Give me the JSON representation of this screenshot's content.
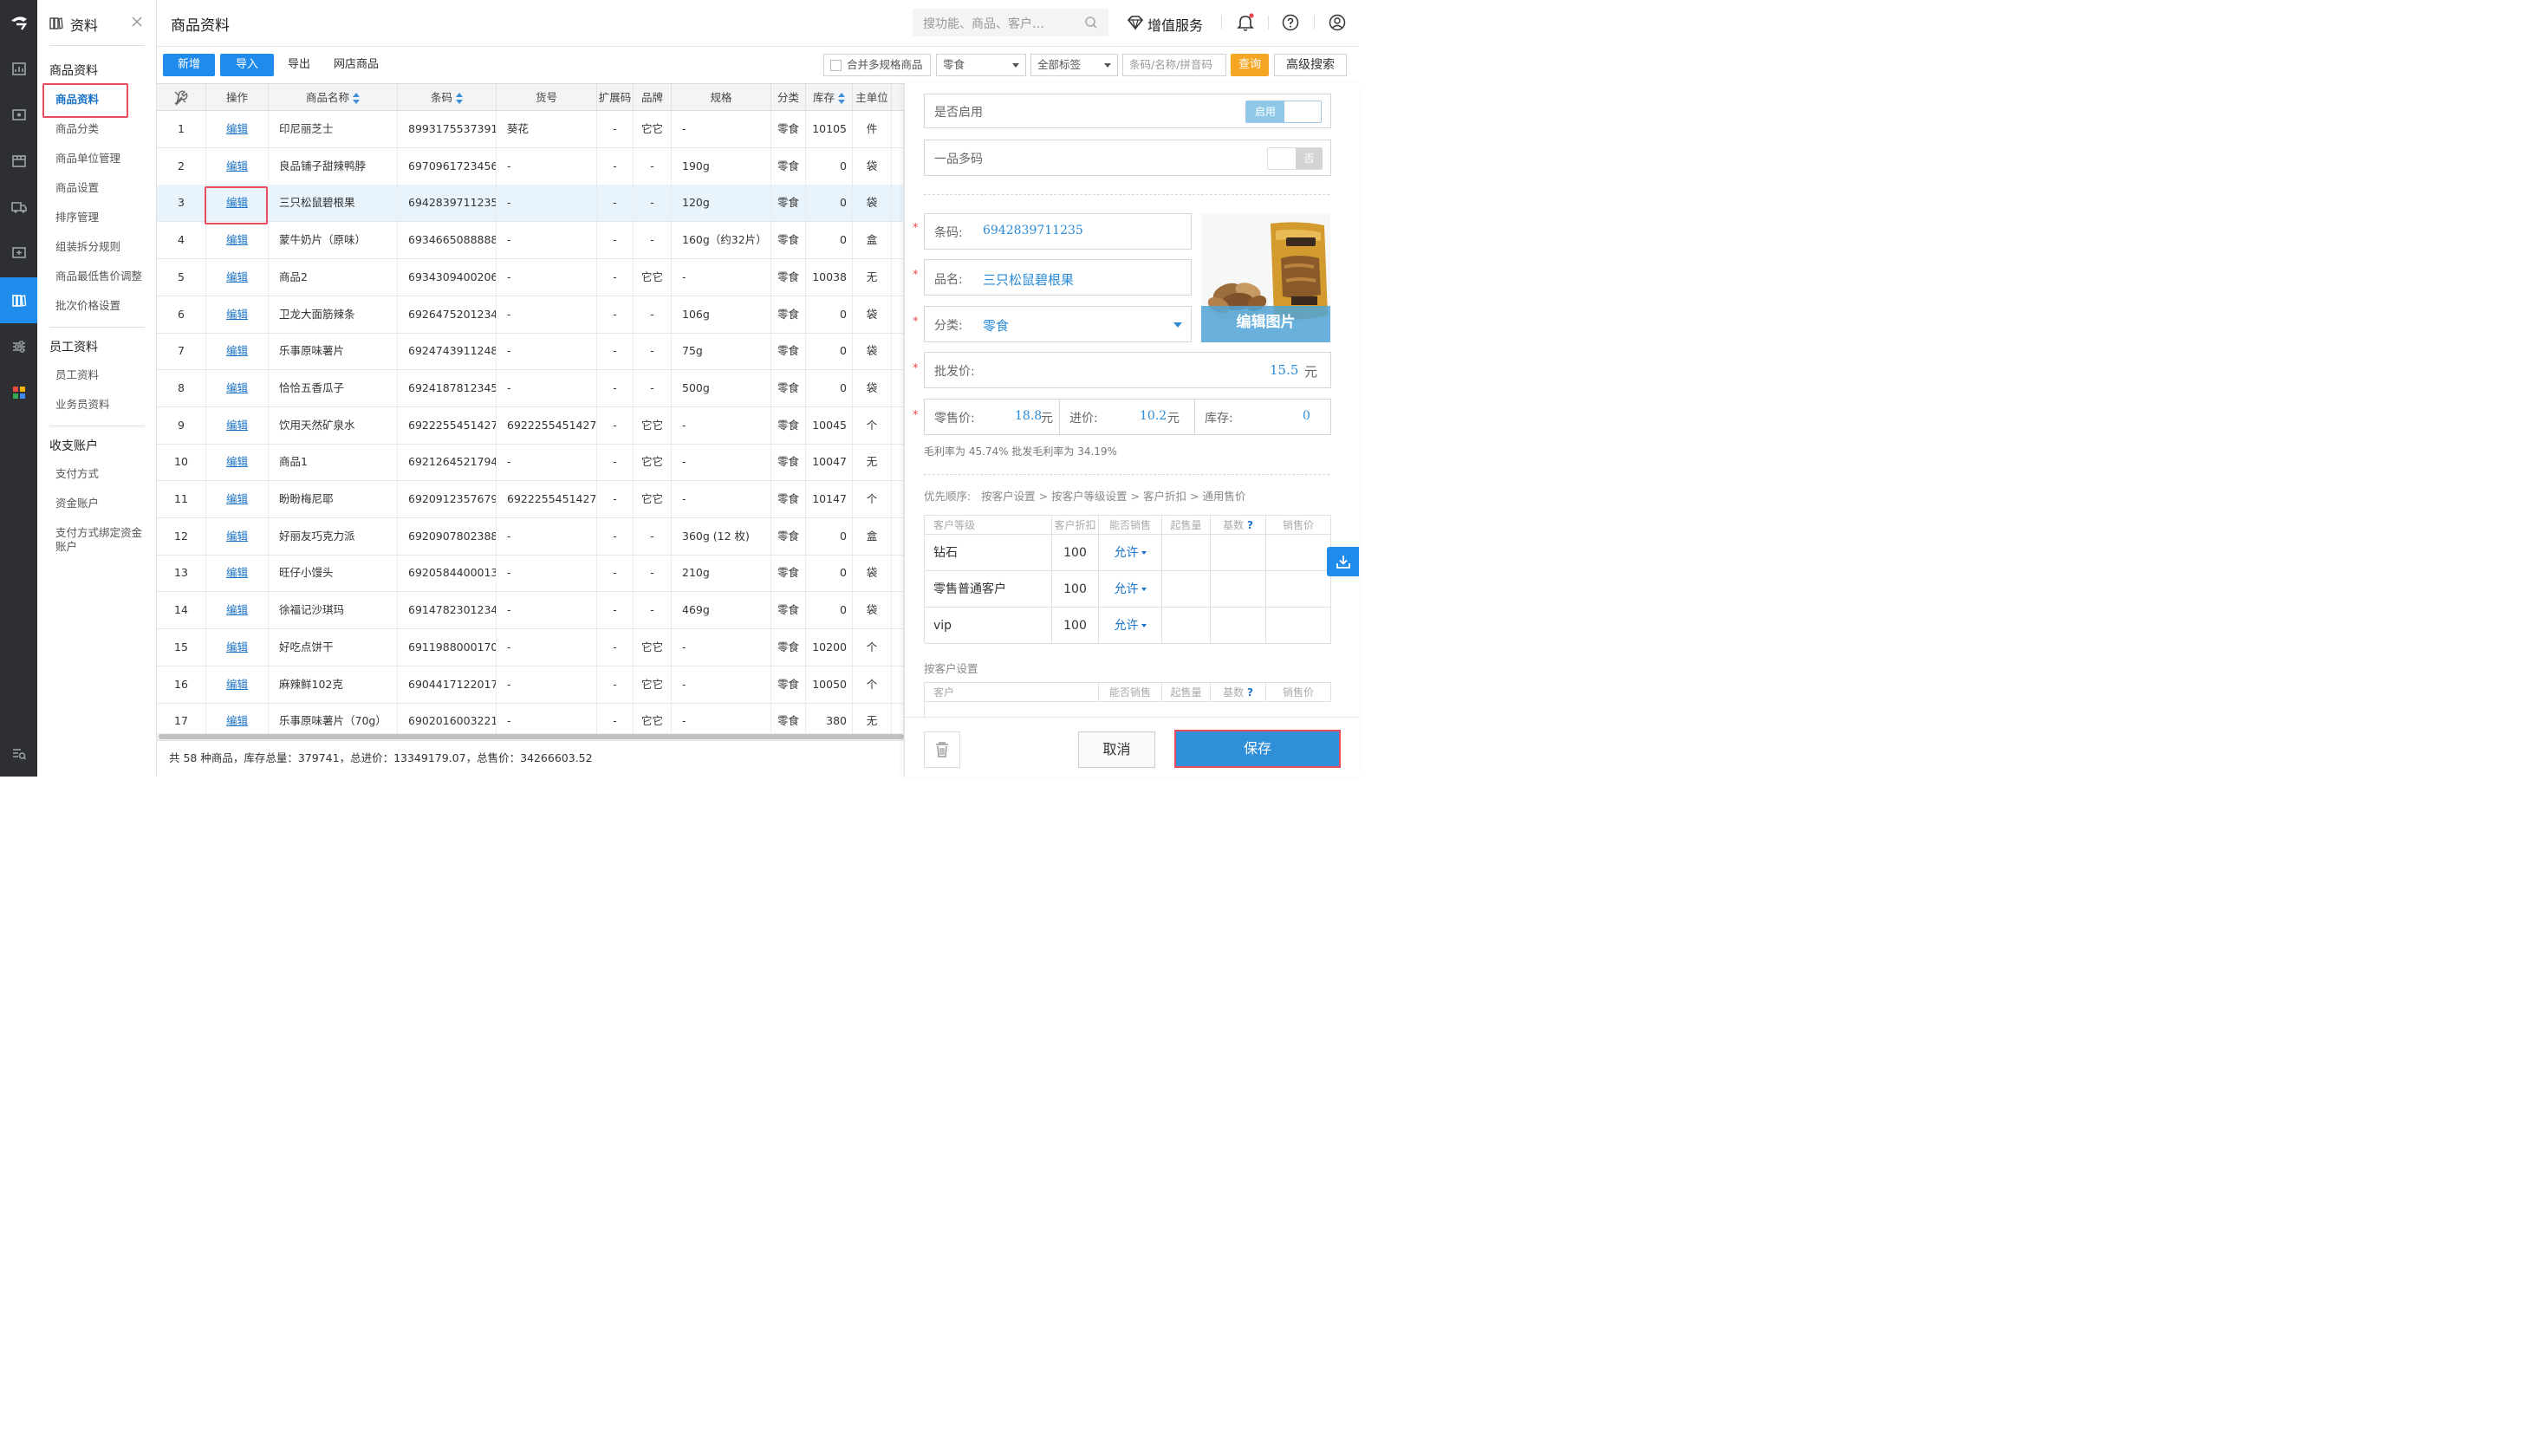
{
  "sidenav": {
    "header_title": "资料",
    "section1_title": "商品资料",
    "section1_items": [
      "商品资料",
      "商品分类",
      "商品单位管理",
      "商品设置",
      "排序管理",
      "组装拆分规则",
      "商品最低售价调整",
      "批次价格设置"
    ],
    "section2_title": "员工资料",
    "section2_items": [
      "员工资料",
      "业务员资料"
    ],
    "section3_title": "收支账户",
    "section3_items": [
      "支付方式",
      "资金账户",
      "支付方式绑定资金账户"
    ]
  },
  "header": {
    "page_title": "商品资料",
    "search_placeholder": "搜功能、商品、客户…",
    "value_service": "增值服务"
  },
  "toolbar": {
    "new_label": "新增",
    "import_label": "导入",
    "export_label": "导出",
    "online_goods_label": "网店商品",
    "merge_spec_label": "合并多规格商品",
    "category_select": "零食",
    "tag_select": "全部标签",
    "search_placeholder": "条码/名称/拼音码",
    "query_label": "查询",
    "advanced_search_label": "高级搜索"
  },
  "table": {
    "columns": [
      "操作",
      "商品名称",
      "条码",
      "货号",
      "扩展码",
      "品牌",
      "规格",
      "分类",
      "库存",
      "主单位"
    ],
    "edit_label": "编辑",
    "rows": [
      {
        "no": "1",
        "name": "印尼丽芝士",
        "barcode": "8993175537391",
        "sku": "葵花",
        "ext": "-",
        "brand": "它它",
        "spec": "-",
        "cat": "零食",
        "stock": "10105",
        "unit": "件"
      },
      {
        "no": "2",
        "name": "良品铺子甜辣鸭脖",
        "barcode": "6970961723456",
        "sku": "-",
        "ext": "-",
        "brand": "-",
        "spec": "190g",
        "cat": "零食",
        "stock": "0",
        "unit": "袋"
      },
      {
        "no": "3",
        "name": "三只松鼠碧根果",
        "barcode": "6942839711235",
        "sku": "-",
        "ext": "-",
        "brand": "-",
        "spec": "120g",
        "cat": "零食",
        "stock": "0",
        "unit": "袋"
      },
      {
        "no": "4",
        "name": "蒙牛奶片（原味）",
        "barcode": "6934665088888",
        "sku": "-",
        "ext": "-",
        "brand": "-",
        "spec": "160g（约32片）",
        "cat": "零食",
        "stock": "0",
        "unit": "盒"
      },
      {
        "no": "5",
        "name": "商品2",
        "barcode": "6934309400206",
        "sku": "-",
        "ext": "-",
        "brand": "它它",
        "spec": "-",
        "cat": "零食",
        "stock": "10038",
        "unit": "无"
      },
      {
        "no": "6",
        "name": "卫龙大面筋辣条",
        "barcode": "6926475201234",
        "sku": "-",
        "ext": "-",
        "brand": "-",
        "spec": "106g",
        "cat": "零食",
        "stock": "0",
        "unit": "袋"
      },
      {
        "no": "7",
        "name": "乐事原味薯片",
        "barcode": "6924743911248",
        "sku": "-",
        "ext": "-",
        "brand": "-",
        "spec": "75g",
        "cat": "零食",
        "stock": "0",
        "unit": "袋"
      },
      {
        "no": "8",
        "name": "恰恰五香瓜子",
        "barcode": "6924187812345",
        "sku": "-",
        "ext": "-",
        "brand": "-",
        "spec": "500g",
        "cat": "零食",
        "stock": "0",
        "unit": "袋"
      },
      {
        "no": "9",
        "name": "饮用天然矿泉水",
        "barcode": "6922255451427",
        "sku": "6922255451427",
        "ext": "-",
        "brand": "它它",
        "spec": "-",
        "cat": "零食",
        "stock": "10045",
        "unit": "个"
      },
      {
        "no": "10",
        "name": "商品1",
        "barcode": "6921264521794",
        "sku": "-",
        "ext": "-",
        "brand": "它它",
        "spec": "-",
        "cat": "零食",
        "stock": "10047",
        "unit": "无"
      },
      {
        "no": "11",
        "name": "盼盼梅尼耶",
        "barcode": "6920912357679",
        "sku": "6922255451427",
        "ext": "-",
        "brand": "它它",
        "spec": "-",
        "cat": "零食",
        "stock": "10147",
        "unit": "个"
      },
      {
        "no": "12",
        "name": "好丽友巧克力派",
        "barcode": "6920907802388",
        "sku": "-",
        "ext": "-",
        "brand": "-",
        "spec": "360g (12 枚)",
        "cat": "零食",
        "stock": "0",
        "unit": "盒"
      },
      {
        "no": "13",
        "name": "旺仔小馒头",
        "barcode": "6920584400013",
        "sku": "-",
        "ext": "-",
        "brand": "-",
        "spec": "210g",
        "cat": "零食",
        "stock": "0",
        "unit": "袋"
      },
      {
        "no": "14",
        "name": "徐福记沙琪玛",
        "barcode": "6914782301234",
        "sku": "-",
        "ext": "-",
        "brand": "-",
        "spec": "469g",
        "cat": "零食",
        "stock": "0",
        "unit": "袋"
      },
      {
        "no": "15",
        "name": "好吃点饼干",
        "barcode": "6911988000170",
        "sku": "-",
        "ext": "-",
        "brand": "它它",
        "spec": "-",
        "cat": "零食",
        "stock": "10200",
        "unit": "个"
      },
      {
        "no": "16",
        "name": "麻辣鲜102克",
        "barcode": "6904417122017",
        "sku": "-",
        "ext": "-",
        "brand": "它它",
        "spec": "-",
        "cat": "零食",
        "stock": "10050",
        "unit": "个"
      },
      {
        "no": "17",
        "name": "乐事原味薯片（70g）",
        "barcode": "6902016003221",
        "sku": "-",
        "ext": "-",
        "brand": "它它",
        "spec": "-",
        "cat": "零食",
        "stock": "380",
        "unit": "无"
      }
    ],
    "footer_summary": "共 58 种商品，库存总量：379741，总进价：13349179.07，总售价：34266603.52"
  },
  "panel": {
    "enabled_label": "是否启用",
    "enabled_toggle": "启用",
    "multi_code_label": "一品多码",
    "multi_code_toggle": "否",
    "barcode_label": "条码:",
    "barcode_value": "6942839711235",
    "name_label": "品名:",
    "name_value": "三只松鼠碧根果",
    "category_label": "分类:",
    "category_value": "零食",
    "edit_image_label": "编辑图片",
    "wholesale_label": "批发价:",
    "wholesale_value": "15.5",
    "yuan": "元",
    "retail_label": "零售价:",
    "retail_value": "18.8",
    "cost_label": "进价:",
    "cost_value": "10.2",
    "stock_label": "库存:",
    "stock_value": "0",
    "margin_text": "毛利率为 45.74% 批发毛利率为 34.19%",
    "priority_text": "优先顺序:   按客户设置 > 按客户等级设置 > 客户折扣 > 通用售价",
    "level_table_headers": [
      "客户等级",
      "客户折扣",
      "能否销售",
      "起售量",
      "基数",
      "销售价"
    ],
    "level_rows": [
      {
        "level": "钻石",
        "discount": "100",
        "allow": "允许"
      },
      {
        "level": "零售普通客户",
        "discount": "100",
        "allow": "允许"
      },
      {
        "level": "vip",
        "discount": "100",
        "allow": "允许"
      }
    ],
    "customer_setting_title": "按客户设置",
    "customer_table_headers": [
      "客户",
      "能否销售",
      "起售量",
      "基数",
      "销售价"
    ],
    "help_mark": "?",
    "cancel_label": "取消",
    "save_label": "保存"
  },
  "colors": {
    "primary": "#1f8ceb",
    "query_orange": "#f5a623",
    "highlight_red": "#e84d5f",
    "dark_rail": "#2d2f33"
  }
}
